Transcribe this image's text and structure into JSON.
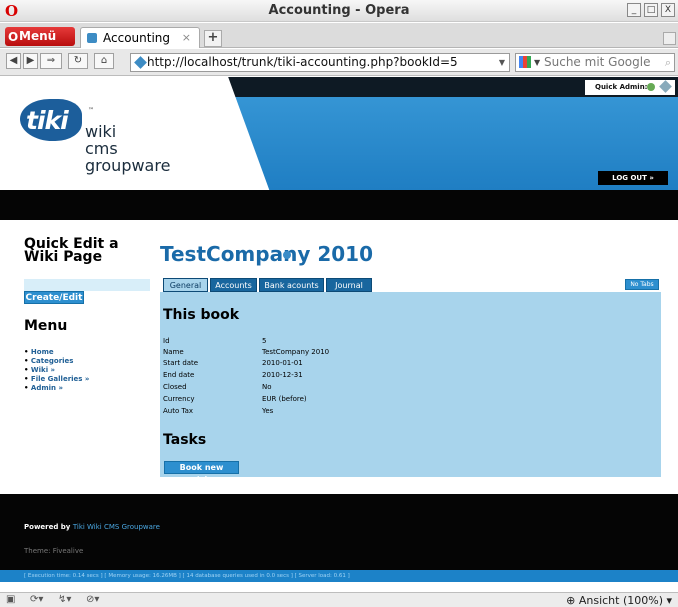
{
  "window": {
    "title": "Accounting - Opera",
    "opera_logo": "O",
    "minimize_glyph": "_",
    "maximize_glyph": "□",
    "close_glyph": "X"
  },
  "tabs": {
    "menu_label": "Menü",
    "menu_logo": "O",
    "active_tab_label": "Accounting",
    "close_glyph": "×",
    "new_tab_glyph": "+"
  },
  "navigation": {
    "back": "◀",
    "forward": "▶",
    "fast_forward": "⇒",
    "reload": "↻",
    "home": "⌂",
    "url": "http://localhost/trunk/tiki-accounting.php?bookId=5",
    "url_dropdown": "▼",
    "search_placeholder": "Suche mit Google",
    "search_engine_dropdown": "▼",
    "search_glyph": "⌕"
  },
  "header": {
    "logo_word": "tiki",
    "logo_tm": "™",
    "logo_lines": [
      "wiki",
      "cms",
      "groupware"
    ],
    "quick_admin": "Quick Admin:",
    "logout": "LOG OUT »"
  },
  "sidebar": {
    "quick_edit_title": "Quick Edit a Wiki Page",
    "create_button": "Create/Edit",
    "menu_title": "Menu",
    "menu_items": [
      "Home",
      "Categories",
      "Wiki »",
      "File Galleries »",
      "Admin »"
    ]
  },
  "main": {
    "page_title": "TestCompany 2010",
    "tabs": [
      "General",
      "Accounts",
      "Bank acounts",
      "Journal"
    ],
    "no_tabs_button": "No Tabs",
    "book_heading": "This book",
    "fields": [
      {
        "label": "Id",
        "value": "5"
      },
      {
        "label": "Name",
        "value": "TestCompany 2010"
      },
      {
        "label": "Start date",
        "value": "2010-01-01"
      },
      {
        "label": "End date",
        "value": "2010-12-31"
      },
      {
        "label": "Closed",
        "value": "No"
      },
      {
        "label": "Currency",
        "value": "EUR (before)"
      },
      {
        "label": "Auto Tax",
        "value": "Yes"
      }
    ],
    "tasks_heading": "Tasks",
    "book_entries_button": "Book new entries"
  },
  "footer": {
    "powered_by": "Powered by",
    "powered_link": "Tiki Wiki CMS Groupware",
    "theme": "Theme: Fivealive",
    "stats": "[ Execution time: 0.14 secs ]   [ Memory usage: 16.26MB ]   [ 14 database queries used in 0.0 secs ]   [ Server load: 0.61 ]"
  },
  "statusbar": {
    "panel_toggle": "▣",
    "speed_dial": "⟳▾",
    "sync": "↯▾",
    "block": "⊘▾",
    "zoom": "⊕ Ansicht (100%) ▾"
  },
  "colors": {
    "accent": "#2d8fcf",
    "header_blue": "#1f7ec3",
    "panel": "#a8d4ec",
    "title_blue": "#1a6aa8"
  }
}
